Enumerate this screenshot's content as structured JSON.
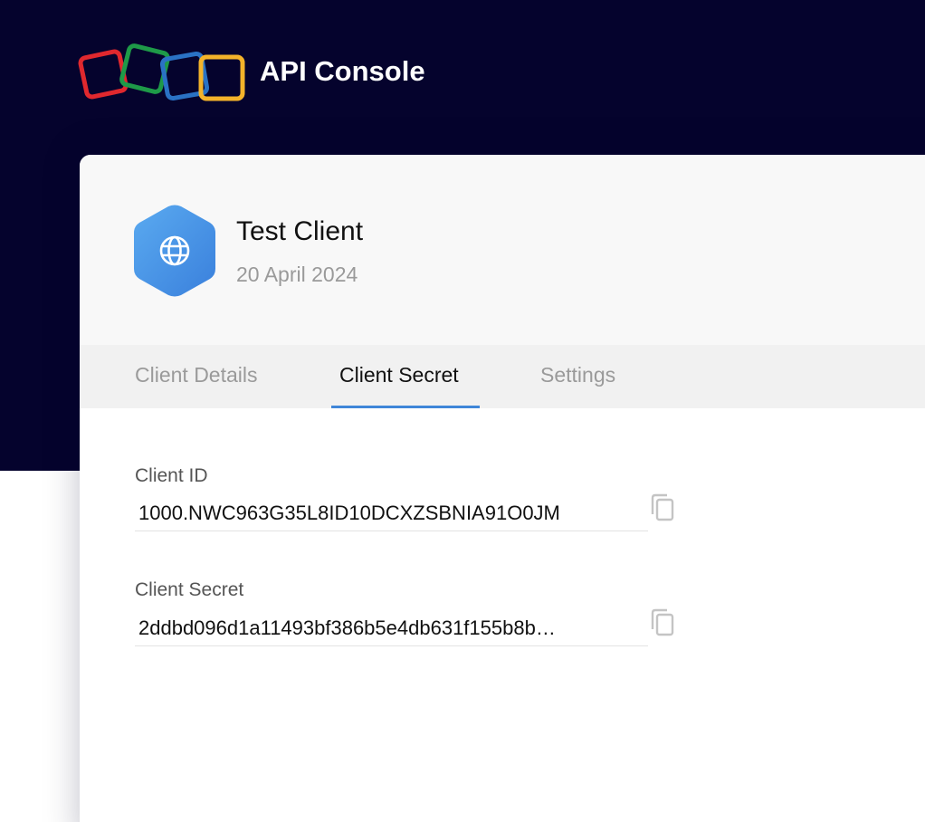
{
  "header": {
    "app_title": "API Console",
    "logo_colors": [
      "#e0282e",
      "#1e9a48",
      "#2a72c4",
      "#f4b32a"
    ]
  },
  "client": {
    "name": "Test Client",
    "date": "20 April 2024",
    "icon": "globe-icon",
    "icon_colors": [
      "#5aaaf0",
      "#3a80dc"
    ]
  },
  "tabs": [
    {
      "label": "Client Details",
      "active": false
    },
    {
      "label": "Client Secret",
      "active": true
    },
    {
      "label": "Settings",
      "active": false
    }
  ],
  "fields": [
    {
      "label": "Client ID",
      "value": "1000.NWC963G35L8ID10DCXZSBNIA91O0JM",
      "icon": "copy-icon"
    },
    {
      "label": "Client Secret",
      "value": "2ddbd096d1a11493bf386b5e4db631f155b8b…",
      "icon": "copy-icon"
    }
  ],
  "colors": {
    "header_bg": "#05032d",
    "accent": "#3f86d8"
  }
}
